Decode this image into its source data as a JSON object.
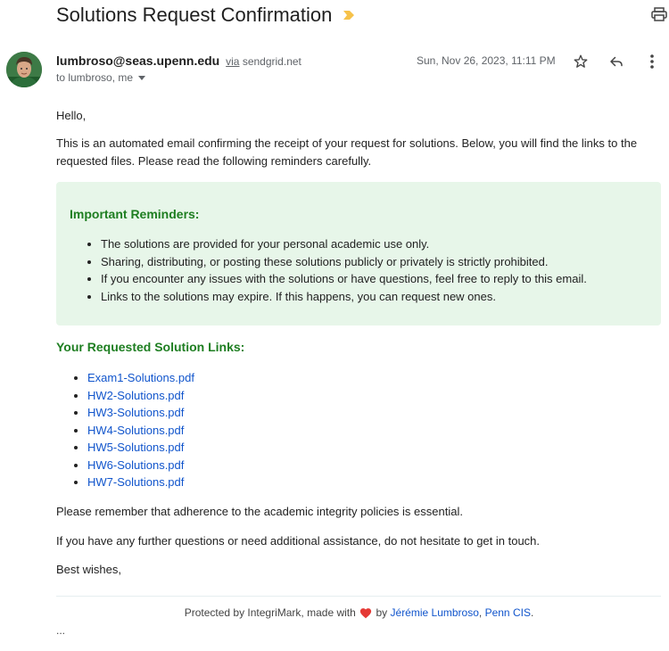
{
  "email": {
    "subject": "Solutions Request Confirmation",
    "sender_email": "lumbroso@seas.upenn.edu",
    "via_label": "via",
    "via_domain": "sendgrid.net",
    "to_text": "to lumbroso, me",
    "date": "Sun, Nov 26, 2023, 11:11 PM",
    "icons": {
      "label": "label-chevron-icon",
      "print": "print-icon",
      "star": "star-icon",
      "reply": "reply-icon",
      "more": "more-vertical-icon",
      "heart": "heart-icon"
    },
    "colors": {
      "accent_green": "#1e7e21",
      "link_blue": "#1155cc",
      "reminder_bg": "#e7f6e9",
      "label_yellow": "#f6c24a",
      "heart_red": "#e53935"
    }
  },
  "body": {
    "greeting": "Hello,",
    "intro": "This is an automated email confirming the receipt of your request for solutions. Below, you will find the links to the requested files. Please read the following reminders carefully.",
    "reminders_title": "Important Reminders:",
    "reminders": [
      "The solutions are provided for your personal academic use only.",
      "Sharing, distributing, or posting these solutions publicly or privately is strictly prohibited.",
      "If you encounter any issues with the solutions or have questions, feel free to reply to this email.",
      "Links to the solutions may expire. If this happens, you can request new ones."
    ],
    "links_title": "Your Requested Solution Links:",
    "links": [
      "Exam1-Solutions.pdf",
      "HW2-Solutions.pdf",
      "HW3-Solutions.pdf",
      "HW4-Solutions.pdf",
      "HW5-Solutions.pdf",
      "HW6-Solutions.pdf",
      "HW7-Solutions.pdf"
    ],
    "closing_1": "Please remember that adherence to the academic integrity policies is essential.",
    "closing_2": "If you have any further questions or need additional assistance, do not hesitate to get in touch.",
    "closing_3": "Best wishes,"
  },
  "footer": {
    "prefix": "Protected by IntegriMark, made with",
    "by": "by",
    "author_link": "Jérémie Lumbroso",
    "comma": ",",
    "org_link": "Penn CIS",
    "suffix": ".",
    "ellipsis": "..."
  }
}
